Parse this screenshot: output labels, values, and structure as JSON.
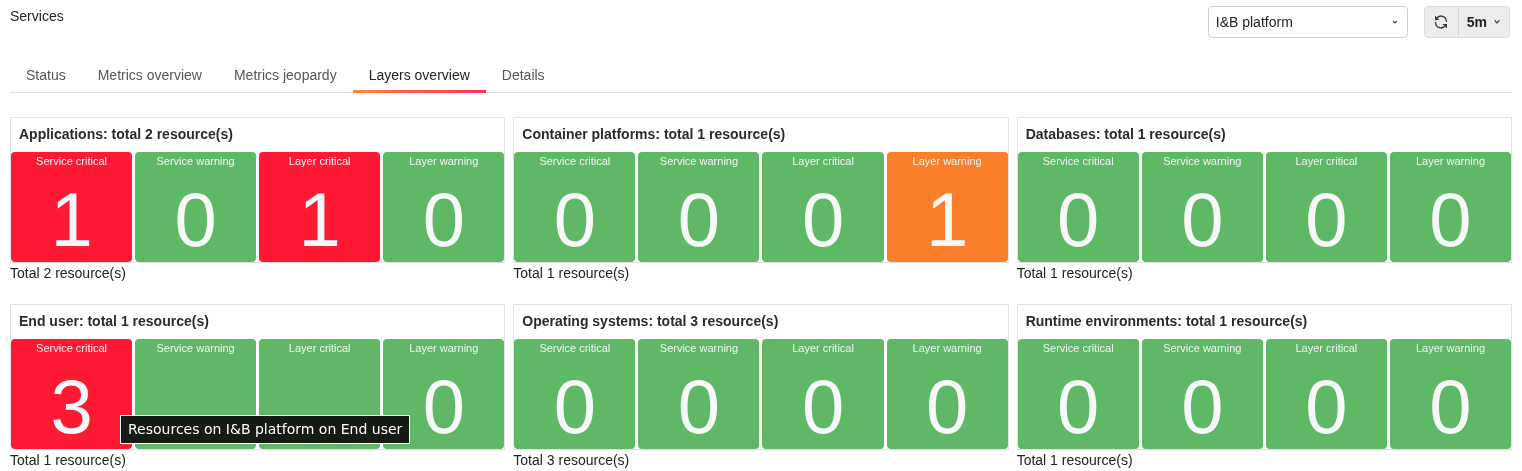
{
  "title": "Services",
  "platform_select": {
    "value": "I&B platform"
  },
  "refresh": {
    "interval": "5m"
  },
  "tabs": [
    {
      "label": "Status",
      "selected": false
    },
    {
      "label": "Metrics overview",
      "selected": false
    },
    {
      "label": "Metrics jeopardy",
      "selected": false
    },
    {
      "label": "Layers overview",
      "selected": true
    },
    {
      "label": "Details",
      "selected": false
    }
  ],
  "panels": [
    {
      "title": "Applications: total 2 resource(s)",
      "footer": "Total 2 resource(s)",
      "tiles": [
        {
          "label": "Service critical",
          "value": "1",
          "color": "#ff1a34"
        },
        {
          "label": "Service warning",
          "value": "0",
          "color": "#5fb865"
        },
        {
          "label": "Layer critical",
          "value": "1",
          "color": "#ff1a34"
        },
        {
          "label": "Layer warning",
          "value": "0",
          "color": "#5fb865"
        }
      ]
    },
    {
      "title": "Container platforms: total 1 resource(s)",
      "footer": "Total 1 resource(s)",
      "tiles": [
        {
          "label": "Service critical",
          "value": "0",
          "color": "#5fb865"
        },
        {
          "label": "Service warning",
          "value": "0",
          "color": "#5fb865"
        },
        {
          "label": "Layer critical",
          "value": "0",
          "color": "#5fb865"
        },
        {
          "label": "Layer warning",
          "value": "1",
          "color": "#fb7e2a"
        }
      ]
    },
    {
      "title": "Databases: total 1 resource(s)",
      "footer": "Total 1 resource(s)",
      "tiles": [
        {
          "label": "Service critical",
          "value": "0",
          "color": "#5fb865"
        },
        {
          "label": "Service warning",
          "value": "0",
          "color": "#5fb865"
        },
        {
          "label": "Layer critical",
          "value": "0",
          "color": "#5fb865"
        },
        {
          "label": "Layer warning",
          "value": "0",
          "color": "#5fb865"
        }
      ]
    },
    {
      "title": "End user: total 1 resource(s)",
      "footer": "Total 1 resource(s)",
      "tooltip": "Resources on I&B platform on End user",
      "tiles": [
        {
          "label": "Service critical",
          "value": "3",
          "color": "#ff1a34"
        },
        {
          "label": "Service warning",
          "color": "#5fb865"
        },
        {
          "label": "Layer critical",
          "color": "#5fb865"
        },
        {
          "label": "Layer warning",
          "value": "0",
          "color": "#5fb865"
        }
      ]
    },
    {
      "title": "Operating systems: total 3 resource(s)",
      "footer": "Total 3 resource(s)",
      "tiles": [
        {
          "label": "Service critical",
          "value": "0",
          "color": "#5fb865"
        },
        {
          "label": "Service warning",
          "value": "0",
          "color": "#5fb865"
        },
        {
          "label": "Layer critical",
          "value": "0",
          "color": "#5fb865"
        },
        {
          "label": "Layer warning",
          "value": "0",
          "color": "#5fb865"
        }
      ]
    },
    {
      "title": "Runtime environments: total 1 resource(s)",
      "footer": "Total 1 resource(s)",
      "tiles": [
        {
          "label": "Service critical",
          "value": "0",
          "color": "#5fb865"
        },
        {
          "label": "Service warning",
          "value": "0",
          "color": "#5fb865"
        },
        {
          "label": "Layer critical",
          "value": "0",
          "color": "#5fb865"
        },
        {
          "label": "Layer warning",
          "value": "0",
          "color": "#5fb865"
        }
      ]
    }
  ]
}
